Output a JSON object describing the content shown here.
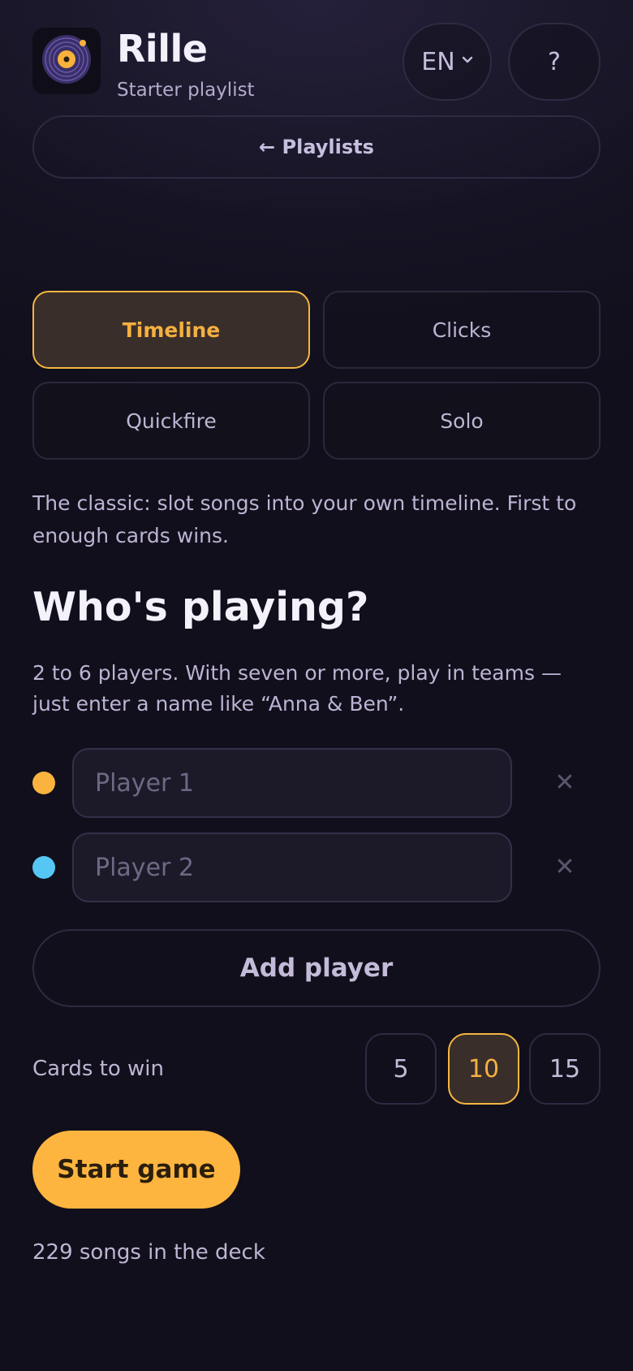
{
  "header": {
    "title": "Rille",
    "subtitle": "Starter playlist",
    "language": "EN",
    "help_label": "?",
    "logo_icon": "vinyl-record-icon",
    "accent": "#fdb540"
  },
  "nav": {
    "back_label": "← Playlists"
  },
  "modes": {
    "items": [
      {
        "label": "Timeline",
        "selected": true
      },
      {
        "label": "Clicks",
        "selected": false
      },
      {
        "label": "Quickfire",
        "selected": false
      },
      {
        "label": "Solo",
        "selected": false
      }
    ],
    "description": "The classic: slot songs into your own timeline. First to enough cards wins."
  },
  "players": {
    "heading": "Who's playing?",
    "note": "2 to 6 players. With seven or more, play in teams — just enter a name like “Anna & Ben”.",
    "list": [
      {
        "placeholder": "Player 1",
        "value": "",
        "color": "#fbb33f"
      },
      {
        "placeholder": "Player 2",
        "value": "",
        "color": "#56c6f5"
      }
    ],
    "remove_label": "✕",
    "add_label": "Add player"
  },
  "cards_to_win": {
    "label": "Cards to win",
    "options": [
      "5",
      "10",
      "15"
    ],
    "selected": "10"
  },
  "start_label": "Start game",
  "deck_count_text": "229 songs in the deck"
}
